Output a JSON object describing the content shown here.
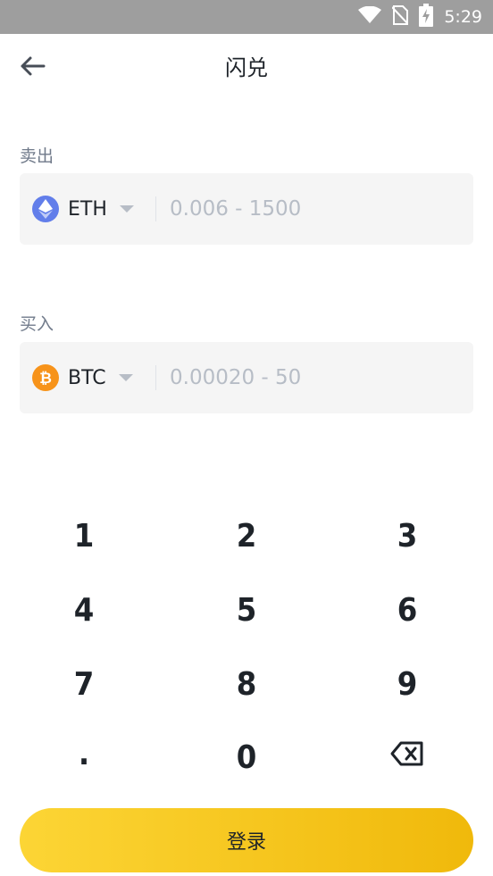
{
  "status_bar": {
    "time": "5:29"
  },
  "header": {
    "title": "闪兑"
  },
  "sell": {
    "label": "卖出",
    "coin": "ETH",
    "placeholder": "0.006 - 1500"
  },
  "buy": {
    "label": "买入",
    "coin": "BTC",
    "placeholder": "0.00020 - 50"
  },
  "keypad": {
    "keys": [
      "1",
      "2",
      "3",
      "4",
      "5",
      "6",
      "7",
      "8",
      "9",
      ".",
      "0"
    ]
  },
  "action": {
    "label": "登录"
  },
  "colors": {
    "accent_start": "#fcd535",
    "accent_end": "#f0b90b",
    "eth": "#627eea",
    "btc": "#f7931a"
  }
}
